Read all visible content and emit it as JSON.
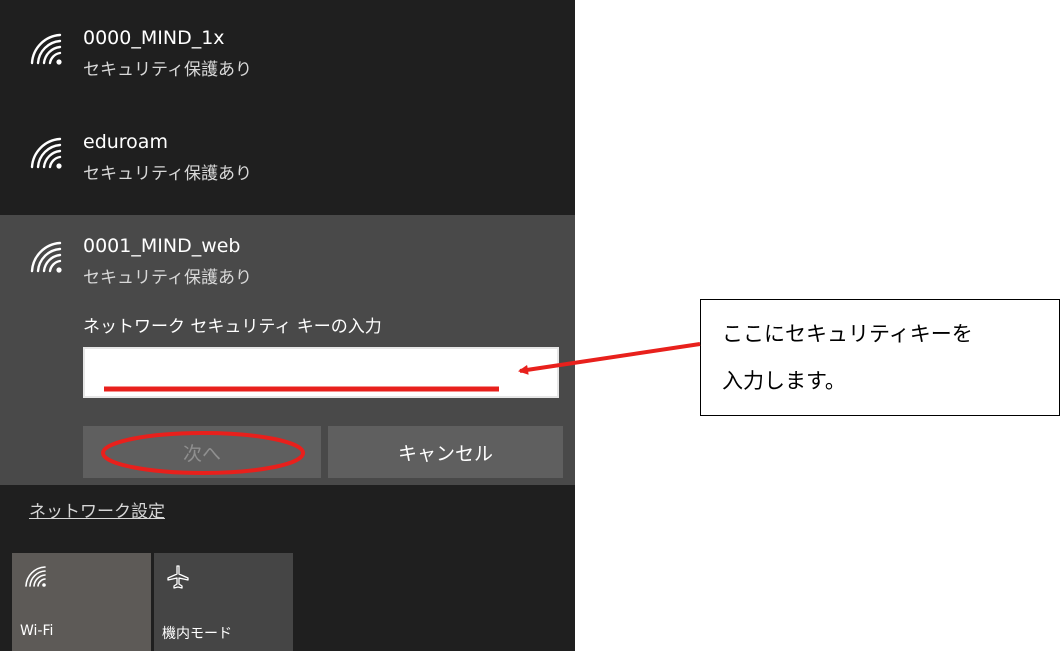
{
  "networks": [
    {
      "ssid": "0000_MIND_1x",
      "status": "セキュリティ保護あり"
    },
    {
      "ssid": "eduroam",
      "status": "セキュリティ保護あり"
    },
    {
      "ssid": "0001_MIND_web",
      "status": "セキュリティ保護あり",
      "key_prompt": "ネットワーク セキュリティ キーの入力",
      "key_value": ""
    }
  ],
  "buttons": {
    "next": "次へ",
    "cancel": "キャンセル"
  },
  "network_settings_link": "ネットワーク設定",
  "quick_actions": [
    {
      "label": "Wi-Fi",
      "icon": "wifi-icon",
      "active": true
    },
    {
      "label": "機内モード",
      "icon": "airplane-icon",
      "active": false
    }
  ],
  "annotation": {
    "line1": "ここにセキュリティキーを",
    "line2": "入力します。"
  },
  "colors": {
    "flyout_bg": "#1f1f1f",
    "selected_bg": "#494949",
    "button_bg": "#5f5f5f",
    "highlight": "#e8201c"
  }
}
